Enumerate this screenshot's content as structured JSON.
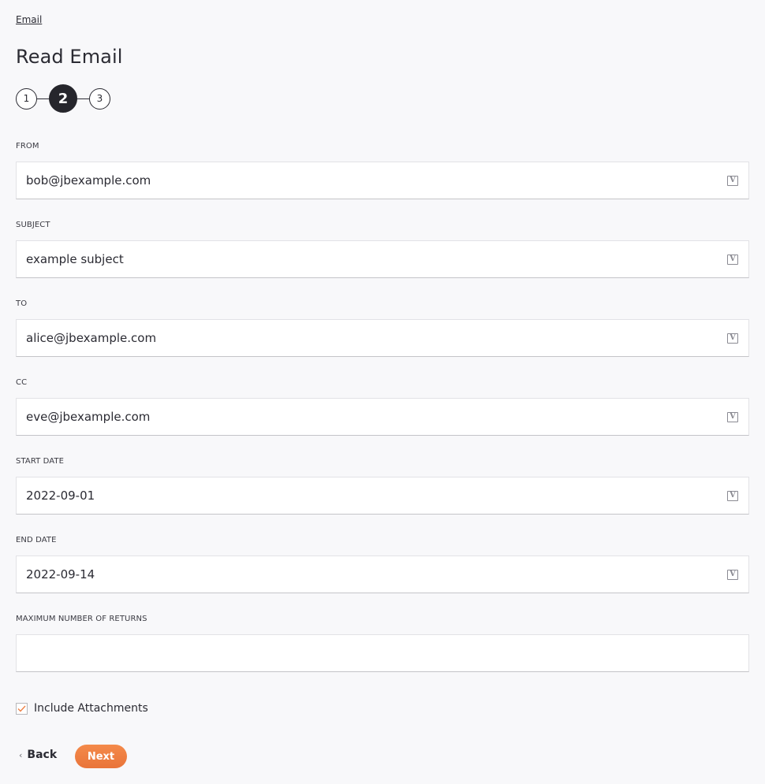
{
  "breadcrumb": {
    "label": "Email"
  },
  "page": {
    "title": "Read Email"
  },
  "stepper": {
    "steps": [
      "1",
      "2",
      "3"
    ],
    "current_step": 2
  },
  "fields": {
    "from": {
      "label": "FROM",
      "value": "bob@jbexample.com",
      "variable_icon": "V"
    },
    "subject": {
      "label": "SUBJECT",
      "value": "example subject",
      "variable_icon": "V"
    },
    "to": {
      "label": "TO",
      "value": "alice@jbexample.com",
      "variable_icon": "V"
    },
    "cc": {
      "label": "CC",
      "value": "eve@jbexample.com",
      "variable_icon": "V"
    },
    "start_date": {
      "label": "START DATE",
      "value": "2022-09-01",
      "variable_icon": "V"
    },
    "end_date": {
      "label": "END DATE",
      "value": "2022-09-14",
      "variable_icon": "V"
    },
    "max_returns": {
      "label": "MAXIMUM NUMBER OF RETURNS",
      "value": ""
    }
  },
  "include_attachments": {
    "label": "Include Attachments",
    "checked": true
  },
  "actions": {
    "back_label": "Back",
    "back_icon": "‹",
    "next_label": "Next"
  },
  "colors": {
    "accent": "#ee7d40",
    "step_active": "#26262c",
    "background": "#f8f8fa"
  }
}
